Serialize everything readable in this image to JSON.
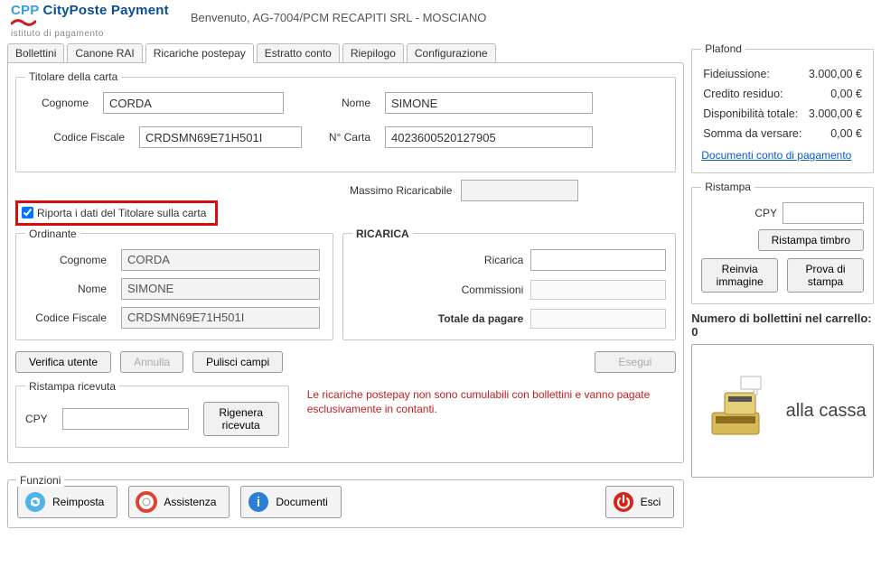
{
  "header": {
    "brand_cp": "CPP",
    "brand_rest": " CityPoste Payment",
    "brand_sub": "istituto di pagamento",
    "welcome": "Benvenuto, AG-7004/PCM RECAPITI SRL - MOSCIANO"
  },
  "tabs": [
    "Bollettini",
    "Canone RAI",
    "Ricariche postepay",
    "Estratto conto",
    "Riepilogo",
    "Configurazione"
  ],
  "active_tab": 2,
  "titolare": {
    "legend": "Titolare della carta",
    "cognome_label": "Cognome",
    "cognome": "CORDA",
    "nome_label": "Nome",
    "nome": "SIMONE",
    "cf_label": "Codice Fiscale",
    "cf": "CRDSMN69E71H501I",
    "numcarta_label": "N° Carta",
    "numcarta": "4023600520127905"
  },
  "massimo_label": "Massimo Ricaricabile",
  "massimo_val": "",
  "riporta_label": "Riporta i dati del Titolare sulla carta",
  "riporta_checked": true,
  "ordinante": {
    "legend": "Ordinante",
    "cognome_label": "Cognome",
    "cognome": "CORDA",
    "nome_label": "Nome",
    "nome": "SIMONE",
    "cf_label": "Codice Fiscale",
    "cf": "CRDSMN69E71H501I"
  },
  "ricarica": {
    "legend": "RICARICA",
    "ricarica_label": "Ricarica",
    "commissioni_label": "Commissioni",
    "totale_label": "Totale da pagare"
  },
  "buttons": {
    "verifica": "Verifica utente",
    "annulla": "Annulla",
    "pulisci": "Pulisci campi",
    "esegui": "Esegui"
  },
  "ristampa_ricevuta": {
    "legend": "Ristampa ricevuta",
    "cpy_label": "CPY",
    "rigenera": "Rigenera ricevuta"
  },
  "warning": "Le ricariche postepay non sono cumulabili con bollettini e vanno pagate esclusivamente in contanti.",
  "funzioni": {
    "legend": "Funzioni",
    "reimposta": "Reimposta",
    "assistenza": "Assistenza",
    "documenti": "Documenti",
    "esci": "Esci"
  },
  "plafond": {
    "legend": "Plafond",
    "rows": [
      {
        "label": "Fideiussione:",
        "value": "3.000,00 €"
      },
      {
        "label": "Credito residuo:",
        "value": "0,00 €"
      },
      {
        "label": "Disponibilità totale:",
        "value": "3.000,00 €"
      },
      {
        "label": "Somma da versare:",
        "value": "0,00 €"
      }
    ],
    "doc_link": "Documenti conto di pagamento"
  },
  "ristampa": {
    "legend": "Ristampa",
    "cpy_label": "CPY",
    "ristampa_timbro": "Ristampa timbro",
    "reinvia": "Reinvia immagine",
    "prova": "Prova di stampa"
  },
  "cart": {
    "title_prefix": "Numero di bollettini nel carrello: ",
    "count": 0,
    "cassa": "alla cassa"
  }
}
